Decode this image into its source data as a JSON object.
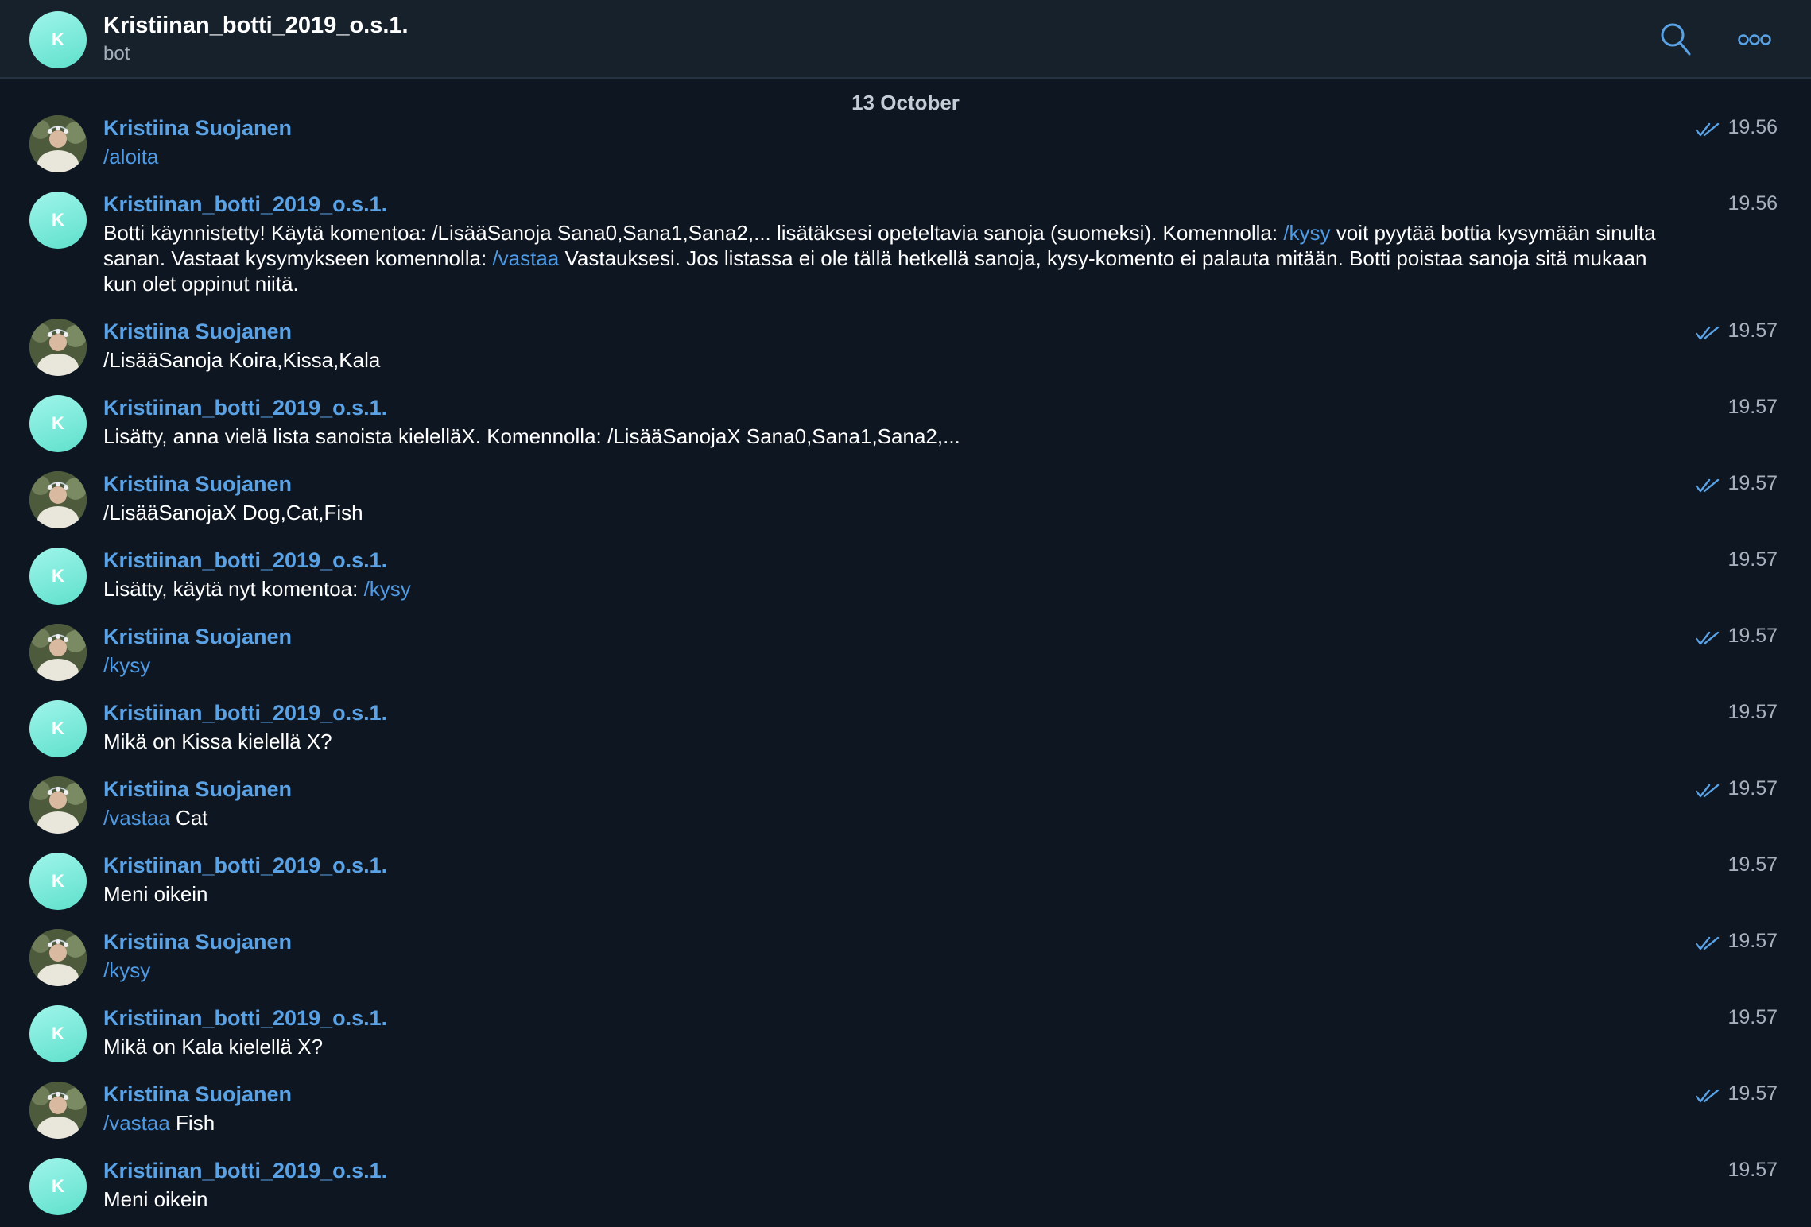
{
  "header": {
    "avatar_letter": "K",
    "title": "Kristiinan_botti_2019_o.s.1.",
    "subtitle": "bot",
    "search_icon": "search-icon",
    "more_icon": "more-icon"
  },
  "date_separator": "13 October",
  "colors": {
    "background": "#0e1621",
    "header_bg": "#17212b",
    "name": "#5aa2e6",
    "command": "#4e9ae4",
    "bot_avatar": "#7eebdc"
  },
  "messages": [
    {
      "sender": "Kristiina Suojanen",
      "time": "19.56",
      "read": true,
      "parts": [
        {
          "t": "/aloita",
          "cmd": true
        }
      ]
    },
    {
      "sender": "Kristiinan_botti_2019_o.s.1.",
      "time": "19.56",
      "read": false,
      "parts": [
        {
          "t": "Botti käynnistetty! Käytä komentoa: /LisääSanoja Sana0,Sana1,Sana2,... lisätäksesi opeteltavia sanoja (suomeksi). Komennolla: ",
          "cmd": false
        },
        {
          "t": "/kysy",
          "cmd": true
        },
        {
          "t": " voit pyytää bottia kysymään sinulta sanan. Vastaat kysymykseen komennolla: ",
          "cmd": false
        },
        {
          "t": "/vastaa",
          "cmd": true
        },
        {
          "t": " Vastauksesi. Jos listassa ei ole tällä hetkellä sanoja, kysy-komento ei palauta mitään. Botti poistaa sanoja sitä mukaan kun olet oppinut niitä.",
          "cmd": false
        }
      ]
    },
    {
      "sender": "Kristiina Suojanen",
      "time": "19.57",
      "read": true,
      "parts": [
        {
          "t": "/LisääSanoja Koira,Kissa,Kala",
          "cmd": false
        }
      ]
    },
    {
      "sender": "Kristiinan_botti_2019_o.s.1.",
      "time": "19.57",
      "read": false,
      "parts": [
        {
          "t": "Lisätty, anna vielä lista sanoista kielelläX. Komennolla: /LisääSanojaX Sana0,Sana1,Sana2,...",
          "cmd": false
        }
      ]
    },
    {
      "sender": "Kristiina Suojanen",
      "time": "19.57",
      "read": true,
      "parts": [
        {
          "t": "/LisääSanojaX Dog,Cat,Fish",
          "cmd": false
        }
      ]
    },
    {
      "sender": "Kristiinan_botti_2019_o.s.1.",
      "time": "19.57",
      "read": false,
      "parts": [
        {
          "t": "Lisätty, käytä nyt komentoa: ",
          "cmd": false
        },
        {
          "t": "/kysy",
          "cmd": true
        }
      ]
    },
    {
      "sender": "Kristiina Suojanen",
      "time": "19.57",
      "read": true,
      "parts": [
        {
          "t": "/kysy",
          "cmd": true
        }
      ]
    },
    {
      "sender": "Kristiinan_botti_2019_o.s.1.",
      "time": "19.57",
      "read": false,
      "parts": [
        {
          "t": "Mikä on Kissa kielellä X?",
          "cmd": false
        }
      ]
    },
    {
      "sender": "Kristiina Suojanen",
      "time": "19.57",
      "read": true,
      "parts": [
        {
          "t": "/vastaa",
          "cmd": true
        },
        {
          "t": " Cat",
          "cmd": false
        }
      ]
    },
    {
      "sender": "Kristiinan_botti_2019_o.s.1.",
      "time": "19.57",
      "read": false,
      "parts": [
        {
          "t": "Meni oikein",
          "cmd": false
        }
      ]
    },
    {
      "sender": "Kristiina Suojanen",
      "time": "19.57",
      "read": true,
      "parts": [
        {
          "t": "/kysy",
          "cmd": true
        }
      ]
    },
    {
      "sender": "Kristiinan_botti_2019_o.s.1.",
      "time": "19.57",
      "read": false,
      "parts": [
        {
          "t": "Mikä on Kala kielellä X?",
          "cmd": false
        }
      ]
    },
    {
      "sender": "Kristiina Suojanen",
      "time": "19.57",
      "read": true,
      "parts": [
        {
          "t": "/vastaa",
          "cmd": true
        },
        {
          "t": " Fish",
          "cmd": false
        }
      ]
    },
    {
      "sender": "Kristiinan_botti_2019_o.s.1.",
      "time": "19.57",
      "read": false,
      "parts": [
        {
          "t": "Meni oikein",
          "cmd": false
        }
      ]
    }
  ]
}
